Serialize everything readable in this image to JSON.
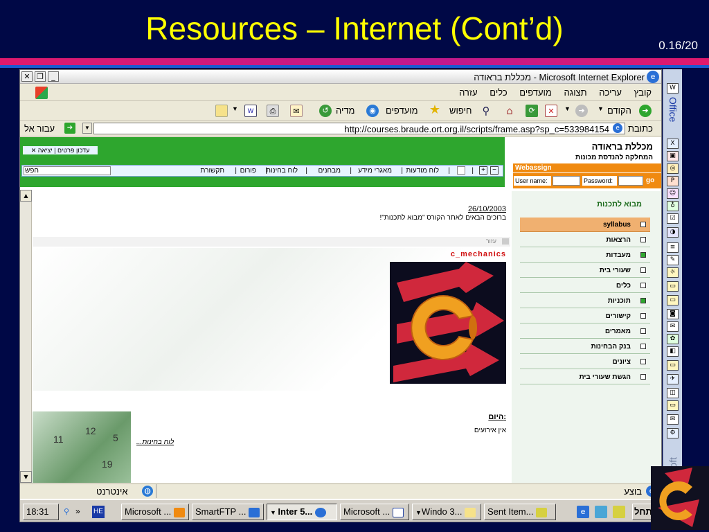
{
  "slide": {
    "title": "Resources – Internet  (Cont’d)",
    "slide_number": "0.16/20"
  },
  "browser": {
    "window_title": "מכללת בראודה - Microsoft Internet Explorer",
    "menu": [
      "קובץ",
      "עריכה",
      "תצוגה",
      "מועדפים",
      "כלים",
      "עזרה"
    ],
    "toolbar": {
      "back": "הקודם",
      "search": "חיפוש",
      "favorites": "מועדפים",
      "media": "מדיה"
    },
    "address_label": "כתובת",
    "address_url": "http://courses.braude.ort.org.il/scripts/frame.asp?sp_c=533984154",
    "go_label": "עבור אל",
    "status_text": "בוצע",
    "status_zone": "אינטרנט"
  },
  "site": {
    "top_links": [
      "עדכון פרטים",
      "יציאה"
    ],
    "nav": [
      "לוח מודעות",
      "מאגרי מידע",
      "מבחנים",
      "לוח בחינות",
      "פורום",
      "תקשורת"
    ],
    "search_button": "חפש",
    "college_name": "מכללת בראודה",
    "department": "המחלקה להנדסת מכונות",
    "webassign": "Webassign",
    "username_label": "User name:",
    "password_label": "Password:",
    "login_button": "go",
    "course_title": "מבוא לתכנות",
    "sidebar": [
      {
        "label": "syllabus",
        "highlight": true
      },
      {
        "label": "הרצאות"
      },
      {
        "label": "מעבדות",
        "green": true
      },
      {
        "label": "שעורי בית"
      },
      {
        "label": "כלים"
      },
      {
        "label": "תוכניות",
        "green": true
      },
      {
        "label": "קישורים"
      },
      {
        "label": "מאמרים"
      },
      {
        "label": "בנק הבחינות"
      },
      {
        "label": "ציונים"
      },
      {
        "label": "הגשת שעורי בית"
      }
    ],
    "date": "26/10/2003",
    "welcome": "ברוכים הבאים לאתר הקורס \"מבוא לתכנות\"!",
    "help_label": "עזור",
    "c_label": "c_mechanics",
    "today_label": "היום:",
    "no_events": "אין אירועים",
    "exam_link": "...לוח בחינות",
    "calendar_numbers": [
      "11",
      "12",
      "5",
      "19"
    ]
  },
  "taskbar": {
    "start": "התחל",
    "time": "18:31",
    "lang": "HE",
    "buttons": [
      "Sent Item...",
      "Windo 3...",
      "Microsoft ...",
      "Inter 5...",
      "SmartFTP ...",
      "Microsoft ..."
    ]
  },
  "office_bar": {
    "top_label": "Office",
    "bottom_label": "Microsoft"
  },
  "colors": {
    "bg": "#000846",
    "title": "#ffff00",
    "accent": "#e01a6c",
    "site_green": "#2ea62e",
    "webassign_orange": "#f08a10"
  }
}
